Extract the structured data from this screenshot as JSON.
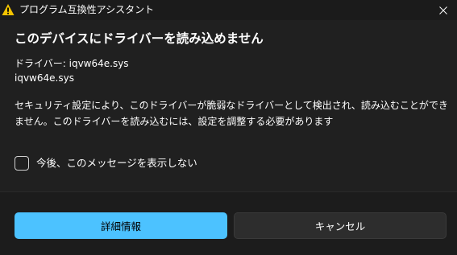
{
  "window": {
    "title": "プログラム互換性アシスタント",
    "title_icon": "warning-icon",
    "close_icon": "close-icon"
  },
  "content": {
    "heading": "このデバイスにドライバーを読み込めません",
    "driver_label_line": "ドライバー: iqvw64e.sys",
    "driver_file_line": "iqvw64e.sys",
    "message": "セキュリティ設定により、このドライバーが脆弱なドライバーとして検出され、読み込むことができません。このドライバーを読み込むには、設定を調整する必要があります",
    "checkbox_label": "今後、このメッセージを表示しない",
    "checkbox_checked": false
  },
  "buttons": {
    "details_label": "詳細情報",
    "cancel_label": "キャンセル"
  },
  "colors": {
    "accent": "#4cc2ff",
    "warning": "#f5c400",
    "background": "#202020"
  }
}
